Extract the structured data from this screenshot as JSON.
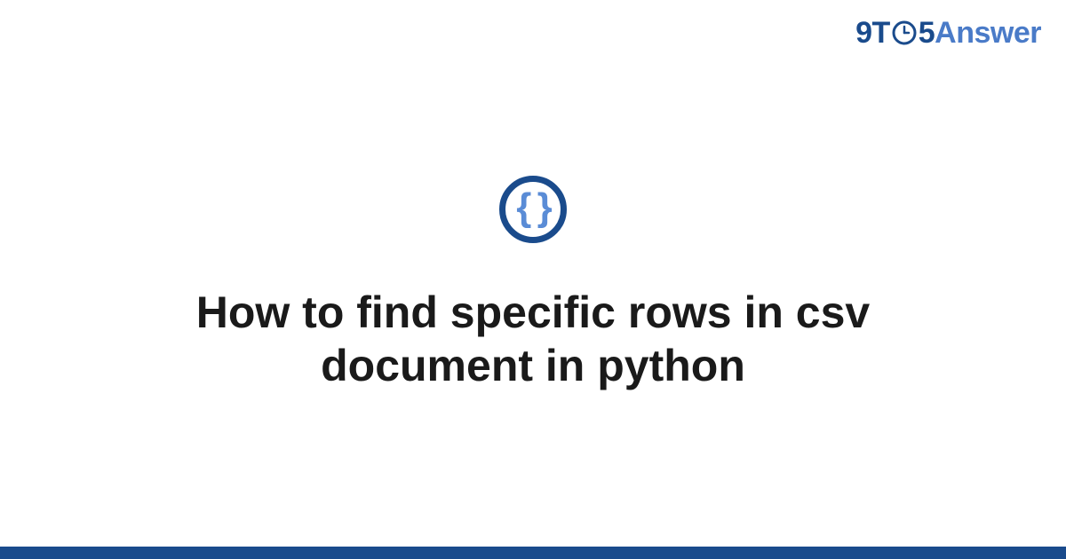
{
  "header": {
    "logo_part1": "9T",
    "logo_part2": "5",
    "logo_part3": "Answer"
  },
  "main": {
    "icon_glyph": "{ }",
    "title": "How to find specific rows in csv document in python"
  },
  "colors": {
    "primary": "#1a4b8c",
    "secondary": "#4a7bc8",
    "brace": "#5a8cd6"
  }
}
